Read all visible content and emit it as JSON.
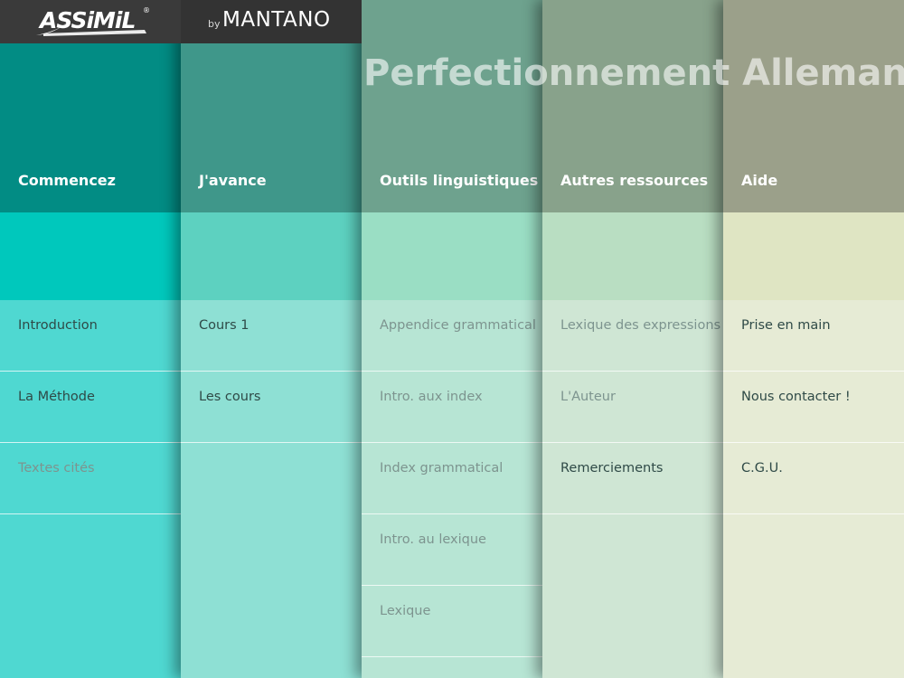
{
  "brand": {
    "logo_text": "ASSiMiL",
    "logo_mark": "®",
    "by": "by",
    "partner": "MANTANO"
  },
  "title": "Perfectionnement Allemand",
  "columns": [
    {
      "header": "Commencez",
      "colors": {
        "top": "#028c84",
        "band": "#00c8bc",
        "bottom": "#4fd8d1"
      },
      "items": [
        {
          "label": "Introduction",
          "enabled": true
        },
        {
          "label": "La Méthode",
          "enabled": true
        },
        {
          "label": "Textes cités",
          "enabled": false
        }
      ]
    },
    {
      "header": "J'avance",
      "colors": {
        "top": "#3f978a",
        "band": "#5dd1c0",
        "bottom": "#8ee0d4"
      },
      "items": [
        {
          "label": "Cours 1",
          "enabled": true
        },
        {
          "label": "Les cours",
          "enabled": true
        }
      ]
    },
    {
      "header": "Outils linguistiques",
      "colors": {
        "top": "#6ea28e",
        "band": "#9adec4",
        "bottom": "#b7e5d4"
      },
      "items": [
        {
          "label": "Appendice grammatical",
          "enabled": false
        },
        {
          "label": "Intro. aux index",
          "enabled": false
        },
        {
          "label": "Index grammatical",
          "enabled": false
        },
        {
          "label": "Intro. au lexique",
          "enabled": false
        },
        {
          "label": "Lexique",
          "enabled": false
        }
      ]
    },
    {
      "header": "Autres ressources",
      "colors": {
        "top": "#88a28b",
        "band": "#b9dec2",
        "bottom": "#cfe6d4"
      },
      "items": [
        {
          "label": "Lexique des expressions",
          "enabled": false
        },
        {
          "label": "L'Auteur",
          "enabled": false
        },
        {
          "label": "Remerciements",
          "enabled": true
        }
      ]
    },
    {
      "header": "Aide",
      "colors": {
        "top": "#9ba08a",
        "band": "#dfe5c3",
        "bottom": "#e6ebd5"
      },
      "items": [
        {
          "label": "Prise en main",
          "enabled": true
        },
        {
          "label": "Nous contacter !",
          "enabled": true
        },
        {
          "label": "C.G.U.",
          "enabled": true
        }
      ]
    }
  ],
  "text_colors": {
    "enabled": "#2f4a47",
    "disabled": "#7d948f"
  }
}
